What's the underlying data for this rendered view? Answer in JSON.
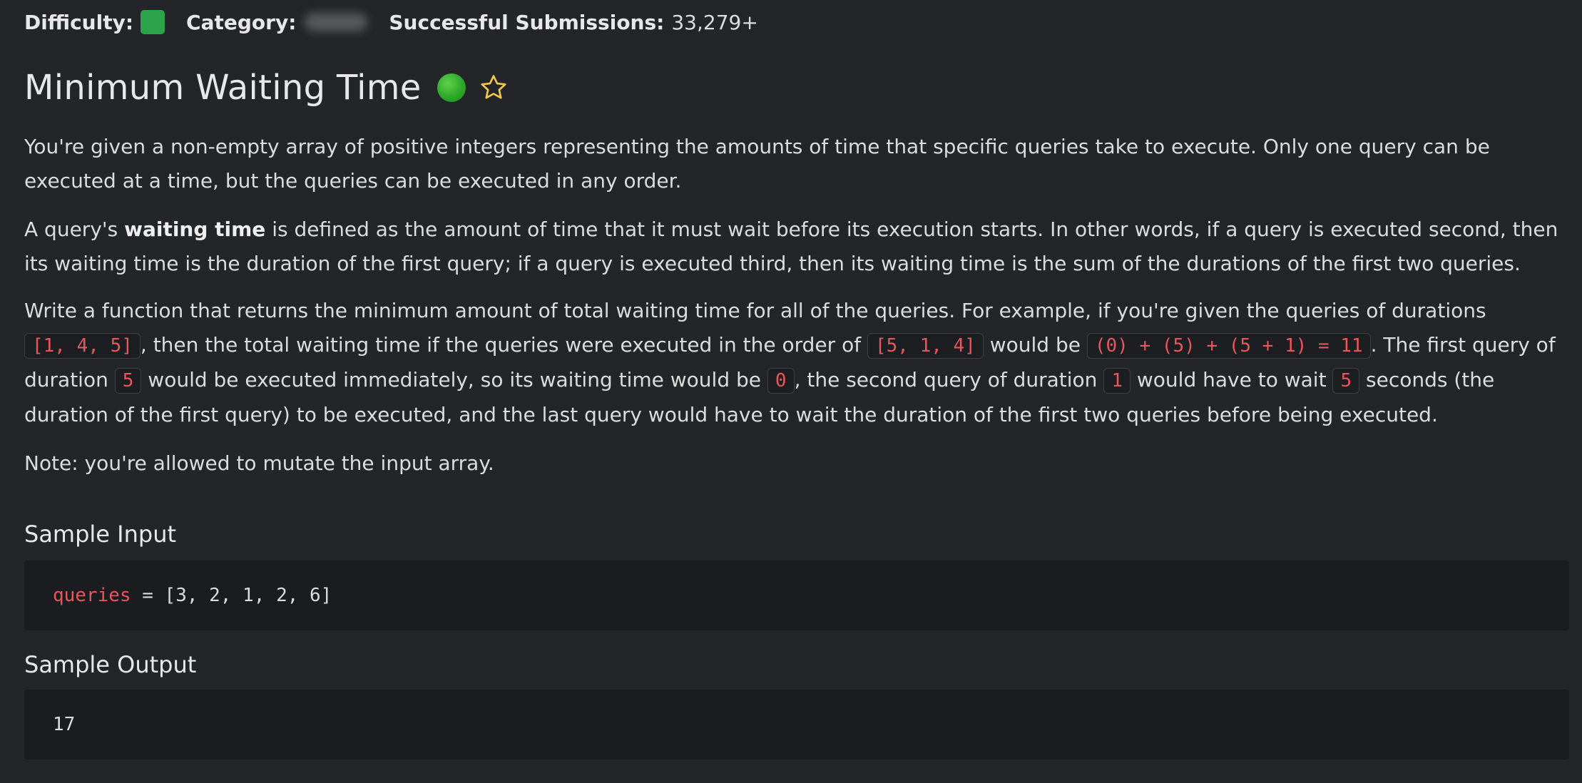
{
  "meta": {
    "difficulty_label": "Difficulty:",
    "category_label": "Category:",
    "submissions_label": "Successful Submissions:",
    "submissions_value": "33,279+",
    "difficulty_color": "#2aa34a"
  },
  "problem": {
    "title": "Minimum Waiting Time",
    "status_icon": "green-circle-icon",
    "favorite_icon": "star-outline-icon"
  },
  "description": {
    "p1": "You're given a non-empty array of positive integers representing the amounts of time that specific queries take to execute. Only one query can be executed at a time, but the queries can be executed in any order.",
    "p2_before": "A query's ",
    "p2_bold": "waiting time",
    "p2_after": " is defined as the amount of time that it must wait before its execution starts. In other words, if a query is executed second, then its waiting time is the duration of the first query; if a query is executed third, then its waiting time is the sum of the durations of the first two queries.",
    "p3_1": "Write a function that returns the minimum amount of total waiting time for all of the queries. For example, if you're given the queries of durations ",
    "p3_code1": "[1, 4, 5]",
    "p3_2": ", then the total waiting time if the queries were executed in the order of ",
    "p3_code2": "[5, 1, 4]",
    "p3_3": " would be ",
    "p3_code3": "(0) + (5) + (5 + 1) = 11",
    "p3_4": ". The first query of duration ",
    "p3_code4": "5",
    "p3_5": " would be executed immediately, so its waiting time would be ",
    "p3_code5": "0",
    "p3_6": ", the second query of duration ",
    "p3_code6": "1",
    "p3_7": " would have to wait ",
    "p3_code7": "5",
    "p3_8": " seconds (the duration of the first query) to be executed, and the last query would have to wait the duration of the first two queries before being executed.",
    "p4": "Note: you're allowed to mutate the input array."
  },
  "sample_input": {
    "heading": "Sample Input",
    "var": "queries",
    "rest": " = [3, 2, 1, 2, 6]"
  },
  "sample_output": {
    "heading": "Sample Output",
    "value": "17"
  },
  "colors": {
    "background": "#242528",
    "code_text": "#e9565b",
    "star": "#f2c94c"
  }
}
